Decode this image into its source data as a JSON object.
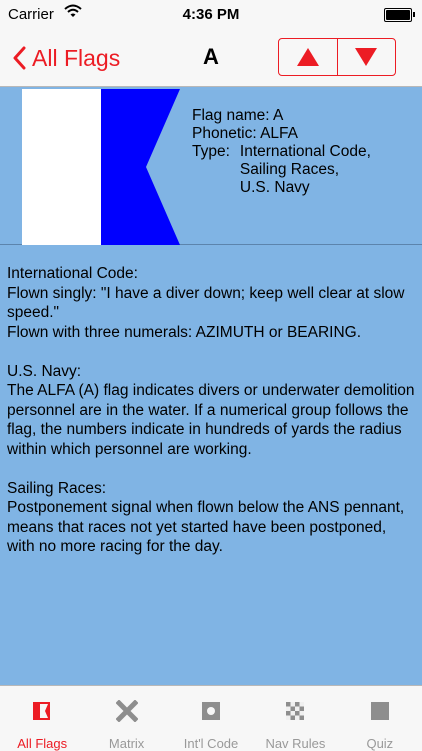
{
  "status_bar": {
    "carrier": "Carrier",
    "time": "4:36 PM"
  },
  "nav": {
    "back_label": "All Flags",
    "title": "A"
  },
  "flag": {
    "name_line": "Flag name: A",
    "phonetic_line": "Phonetic: ALFA",
    "type_label": "Type:",
    "types": [
      "International Code,",
      "Sailing Races,",
      "U.S. Navy"
    ],
    "colors": {
      "hoist": "#ffffff",
      "fly": "#0000ff"
    }
  },
  "description": {
    "intl_heading": "International Code:",
    "intl_singly": "Flown singly: \"I have a diver down; keep well clear at slow speed.\"",
    "intl_numerals": "Flown with three numerals: AZIMUTH or BEARING.",
    "navy_heading": "U.S. Navy:",
    "navy_text": "The ALFA (A) flag indicates divers or underwater demolition personnel are in the water. If a numerical group follows the flag, the numbers indicate in hundreds of yards the radius within which personnel are working.",
    "sailing_heading": "Sailing Races:",
    "sailing_text": "Postponement signal when flown below the ANS pennant, means that races not yet started have been postponed, with no more racing for the day."
  },
  "tabs": [
    {
      "label": "All Flags",
      "icon": "flag-icon",
      "active": true
    },
    {
      "label": "Matrix",
      "icon": "x-cross-icon",
      "active": false
    },
    {
      "label": "Int'l Code",
      "icon": "square-dot-icon",
      "active": false
    },
    {
      "label": "Nav Rules",
      "icon": "checkerboard-icon",
      "active": false
    },
    {
      "label": "Quiz",
      "icon": "square-icon",
      "active": false
    }
  ],
  "theme": {
    "accent": "#ec1c24",
    "background": "#80b4e4",
    "inactive_icon": "#8e8e8e"
  }
}
